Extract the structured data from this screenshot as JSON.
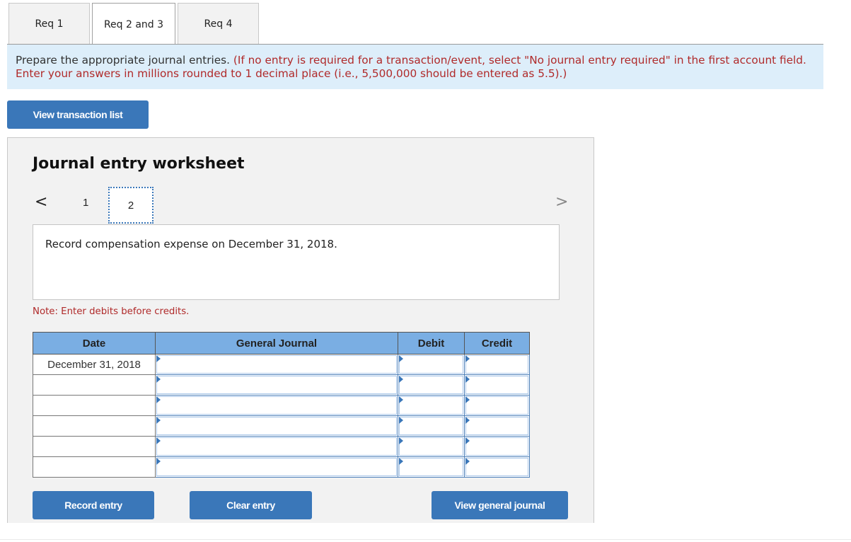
{
  "tabs": [
    {
      "label": "Req 1",
      "active": false
    },
    {
      "label": "Req 2 and 3",
      "active": true
    },
    {
      "label": "Req 4",
      "active": false
    }
  ],
  "instructions": {
    "main": "Prepare the appropriate journal entries.",
    "detail": "(If no entry is required for a transaction/event, select \"No journal entry required\" in the first account field. Enter your answers in millions rounded to 1 decimal place (i.e., 5,500,000 should be entered as 5.5).)"
  },
  "buttons": {
    "view_transaction_list": "View transaction list",
    "record_entry": "Record entry",
    "clear_entry": "Clear entry",
    "view_general_journal": "View general journal"
  },
  "worksheet": {
    "title": "Journal entry worksheet",
    "nav": {
      "prev_icon": "<",
      "next_icon": ">",
      "pages": [
        "1",
        "2"
      ],
      "current_page": "2"
    },
    "description": "Record compensation expense on December 31, 2018.",
    "note": "Note: Enter debits before credits."
  },
  "journal_table": {
    "columns": [
      "Date",
      "General Journal",
      "Debit",
      "Credit"
    ],
    "rows": [
      {
        "date": "December 31, 2018",
        "account": "",
        "debit": "",
        "credit": ""
      },
      {
        "date": "",
        "account": "",
        "debit": "",
        "credit": ""
      },
      {
        "date": "",
        "account": "",
        "debit": "",
        "credit": ""
      },
      {
        "date": "",
        "account": "",
        "debit": "",
        "credit": ""
      },
      {
        "date": "",
        "account": "",
        "debit": "",
        "credit": ""
      },
      {
        "date": "",
        "account": "",
        "debit": "",
        "credit": ""
      }
    ]
  },
  "colors": {
    "button_blue": "#3a77b9",
    "header_blue": "#7aaee3",
    "instruction_bg": "#ddeefa",
    "note_red": "#b02a2a"
  }
}
